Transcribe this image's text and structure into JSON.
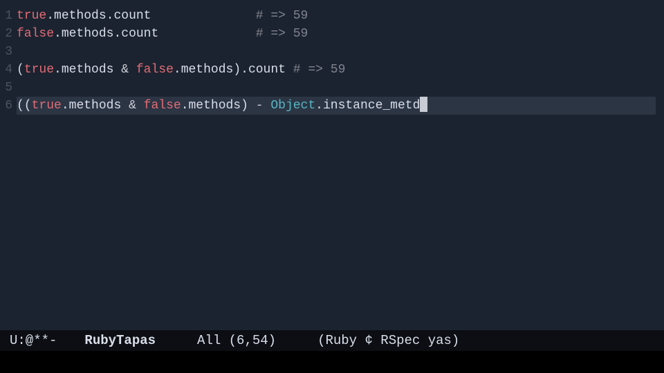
{
  "lines": [
    {
      "num": "1"
    },
    {
      "num": "2"
    },
    {
      "num": "3"
    },
    {
      "num": "4"
    },
    {
      "num": "5"
    },
    {
      "num": "6"
    }
  ],
  "code": {
    "l1": {
      "true": "true",
      "dot1": ".",
      "methods": "methods",
      "dot2": ".",
      "count": "count",
      "pad": "              ",
      "comment": "# => 59"
    },
    "l2": {
      "false": "false",
      "dot1": ".",
      "methods": "methods",
      "dot2": ".",
      "count": "count",
      "pad": "             ",
      "comment": "# => 59"
    },
    "l4": {
      "lp": "(",
      "true": "true",
      "dot1": ".",
      "m1": "methods",
      "amp": " & ",
      "false": "false",
      "dot2": ".",
      "m2": "methods",
      "rp": ")",
      "dot3": ".",
      "count": "count",
      "pad": " ",
      "comment": "# => 59"
    },
    "l6": {
      "lp": "((",
      "true": "true",
      "dot1": ".",
      "m1": "methods",
      "amp": " & ",
      "false": "false",
      "dot2": ".",
      "m2": "methods",
      "rp": ")",
      "minus": " - ",
      "obj": "Object",
      "dot3": ".",
      "im": "instance_metd"
    }
  },
  "modeline": {
    "left": "U:@**-",
    "buffer": "RubyTapas",
    "position": "All (6,54)",
    "modes": "(Ruby ¢ RSpec yas)"
  }
}
